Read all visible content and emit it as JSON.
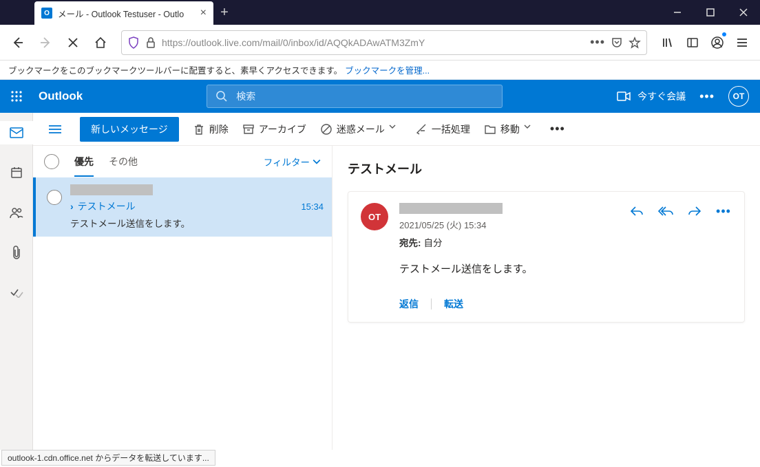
{
  "browser": {
    "tab_title": "メール - Outlook Testuser - Outlo",
    "url_display": "https://outlook.live.com/mail/0/inbox/id/AQQkADAwATM3ZmY",
    "bookmark_hint": "ブックマークをこのブックマークツールバーに配置すると、素早くアクセスできます。",
    "bookmark_link": "ブックマークを管理...",
    "status_text": "outlook-1.cdn.office.net からデータを転送しています..."
  },
  "header": {
    "app_name": "Outlook",
    "search_placeholder": "検索",
    "meet_now": "今すぐ会議",
    "avatar_initials": "OT"
  },
  "commands": {
    "new_message": "新しいメッセージ",
    "delete": "削除",
    "archive": "アーカイブ",
    "junk": "迷惑メール",
    "sweep": "一括処理",
    "move": "移動"
  },
  "list": {
    "tab_focused": "優先",
    "tab_other": "その他",
    "filter": "フィルター",
    "item": {
      "subject": "テストメール",
      "time": "15:34",
      "preview": "テストメール送信をします。"
    }
  },
  "reading": {
    "subject": "テストメール",
    "avatar_initials": "OT",
    "date": "2021/05/25 (火) 15:34",
    "to_label": "宛先:",
    "to_value": "自分",
    "body": "テストメール送信をします。",
    "reply": "返信",
    "forward": "転送"
  }
}
